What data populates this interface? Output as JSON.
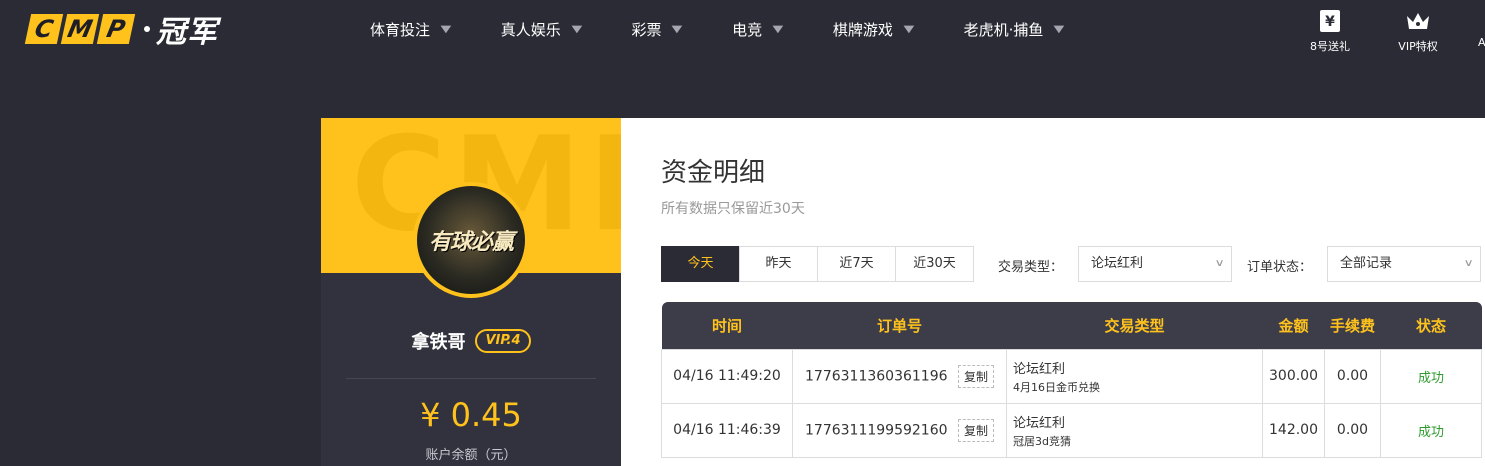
{
  "logo": {
    "letters": [
      "C",
      "M",
      "P"
    ],
    "brand": "冠军"
  },
  "menu": [
    {
      "label": "体育投注"
    },
    {
      "label": "真人娱乐"
    },
    {
      "label": "彩票"
    },
    {
      "label": "电竞"
    },
    {
      "label": "棋牌游戏"
    },
    {
      "label": "老虎机·捕鱼"
    }
  ],
  "nav_right": [
    {
      "label": "8号送礼",
      "icon": "yen-ticket-icon"
    },
    {
      "label": "VIP特权",
      "icon": "crown-icon"
    }
  ],
  "nav_trunc": "A",
  "profile": {
    "banner_text": "CMP",
    "avatar_text": "有球必赢",
    "username": "拿铁哥",
    "vip": "VIP.4",
    "balance": "¥ 0.45",
    "balance_label": "账户余额（元）"
  },
  "content": {
    "title": "资金明细",
    "subtitle": "所有数据只保留近30天",
    "date_tabs": [
      "今天",
      "昨天",
      "近7天",
      "近30天"
    ],
    "active_tab": 0,
    "filters": {
      "type_label": "交易类型：",
      "type_value": "论坛红利",
      "status_label": "订单状态：",
      "status_value": "全部记录"
    },
    "table": {
      "headers": [
        "时间",
        "订单号",
        "交易类型",
        "金额",
        "手续费",
        "状态"
      ],
      "copy_label": "复制",
      "rows": [
        {
          "time": "04/16 11:49:20",
          "order": "1776311360361196",
          "type": "论坛红利",
          "type_sub": "4月16日金币兑换",
          "amount": "300.00",
          "fee": "0.00",
          "status": "成功"
        },
        {
          "time": "04/16 11:46:39",
          "order": "1776311199592160",
          "type": "论坛红利",
          "type_sub": "冠居3d竞猜",
          "amount": "142.00",
          "fee": "0.00",
          "status": "成功"
        }
      ]
    }
  },
  "colors": {
    "accent": "#ffc21c",
    "dark_bg": "#2b2b35",
    "header_bg": "#3d3d4a",
    "success": "#2e9b2e"
  }
}
